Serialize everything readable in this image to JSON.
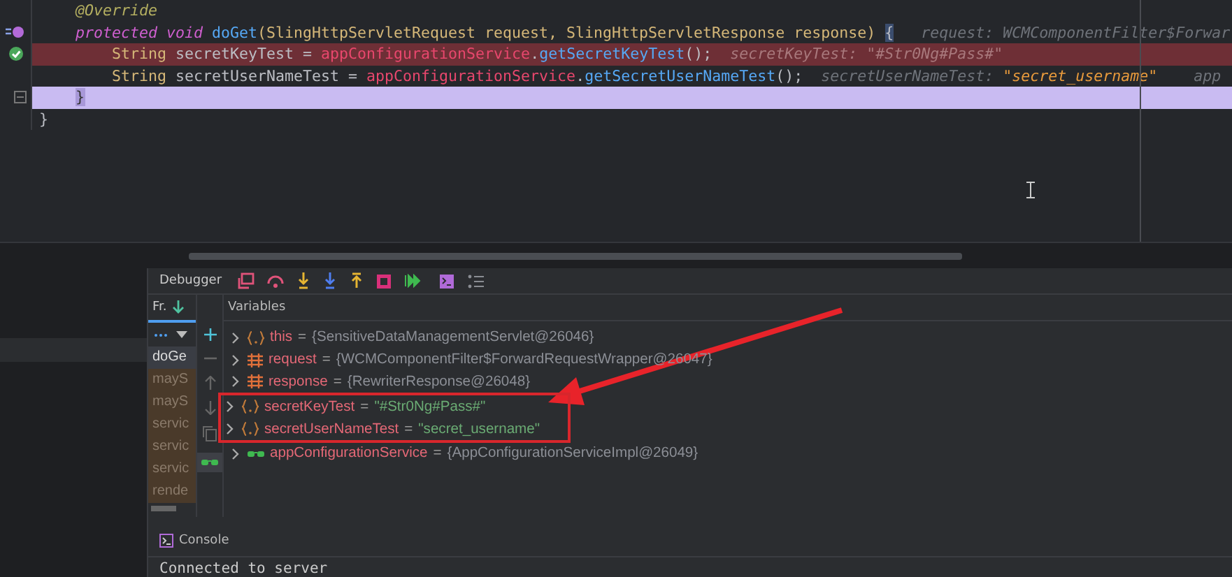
{
  "editor": {
    "lines": [
      {
        "kind": "annotation",
        "breakpoint": false,
        "current": false,
        "tokens": [
          {
            "text": "@Override",
            "kind": "annotation"
          }
        ]
      },
      {
        "kind": "method",
        "breakpoint": false,
        "current": false,
        "tokens": [
          {
            "text": "protected void ",
            "kind": "keyword"
          },
          {
            "text": "doGet",
            "kind": "method"
          },
          {
            "text": "(SlingHttpServletRequest request, SlingHttpServletResponse response) ",
            "kind": "type"
          },
          {
            "text": "{",
            "kind": "brace"
          },
          {
            "text": "   request: WCMComponentFilter$Forwar",
            "kind": "hint"
          }
        ]
      },
      {
        "kind": "statement",
        "breakpoint": true,
        "current": false,
        "tokens": [
          {
            "text": "String ",
            "kind": "type"
          },
          {
            "text": "secretKeyTest = ",
            "kind": "plain"
          },
          {
            "text": "appConfigurationService",
            "kind": "field"
          },
          {
            "text": ".",
            "kind": "plain"
          },
          {
            "text": "getSecretKeyTest",
            "kind": "call"
          },
          {
            "text": "();  ",
            "kind": "plain"
          },
          {
            "text": "secretKeyTest: \"#Str0Ng#Pass#\"",
            "kind": "hint"
          }
        ]
      },
      {
        "kind": "statement",
        "breakpoint": false,
        "current": false,
        "tokens": [
          {
            "text": "String ",
            "kind": "type"
          },
          {
            "text": "secretUserNameTest = ",
            "kind": "plain"
          },
          {
            "text": "appConfigurationService",
            "kind": "field"
          },
          {
            "text": ".",
            "kind": "plain"
          },
          {
            "text": "getSecretUserNameTest",
            "kind": "call"
          },
          {
            "text": "();  ",
            "kind": "plain"
          },
          {
            "text": "secretUserNameTest: ",
            "kind": "hint"
          },
          {
            "text": "\"secret_username\"",
            "kind": "hintvalue"
          },
          {
            "text": "    app",
            "kind": "hint"
          }
        ]
      },
      {
        "kind": "method_end",
        "breakpoint": false,
        "current": true,
        "tokens": [
          {
            "text": "}",
            "kind": "brace"
          }
        ]
      },
      {
        "kind": "class_end",
        "breakpoint": false,
        "current": false,
        "tokens": [
          {
            "text": "}",
            "kind": "plain"
          }
        ]
      }
    ]
  },
  "debugger": {
    "title": "Debugger",
    "frames_tab": "Fr.",
    "variables_tab": "Variables",
    "frames": [
      {
        "text": "doGe",
        "selected": true,
        "library": false
      },
      {
        "text": "mayS",
        "selected": false,
        "library": true
      },
      {
        "text": "mayS",
        "selected": false,
        "library": true
      },
      {
        "text": "servic",
        "selected": false,
        "library": true
      },
      {
        "text": "servic",
        "selected": false,
        "library": true
      },
      {
        "text": "servic",
        "selected": false,
        "library": true
      },
      {
        "text": "rende",
        "selected": false,
        "library": true
      }
    ],
    "variables": [
      {
        "kind": "object",
        "name": "this",
        "operator": "=",
        "value": "{SensitiveDataManagementServlet@26046}",
        "is_string": false,
        "boxed": false
      },
      {
        "kind": "fields",
        "name": "request",
        "operator": "=",
        "value": "{WCMComponentFilter$ForwardRequestWrapper@26047}",
        "is_string": false,
        "boxed": false
      },
      {
        "kind": "fields",
        "name": "response",
        "operator": "=",
        "value": "{RewriterResponse@26048}",
        "is_string": false,
        "boxed": false
      },
      {
        "kind": "object",
        "name": "secretKeyTest",
        "operator": "=",
        "value": "\"#Str0Ng#Pass#\"",
        "is_string": true,
        "boxed": true
      },
      {
        "kind": "object",
        "name": "secretUserNameTest",
        "operator": "=",
        "value": "\"secret_username\"",
        "is_string": true,
        "boxed": true
      },
      {
        "kind": "watch",
        "name": "appConfigurationService",
        "operator": "=",
        "value": "{AppConfigurationServiceImpl@26049}",
        "is_string": false,
        "boxed": false
      }
    ],
    "console_tab": "Console",
    "console_output": "Connected to server"
  }
}
